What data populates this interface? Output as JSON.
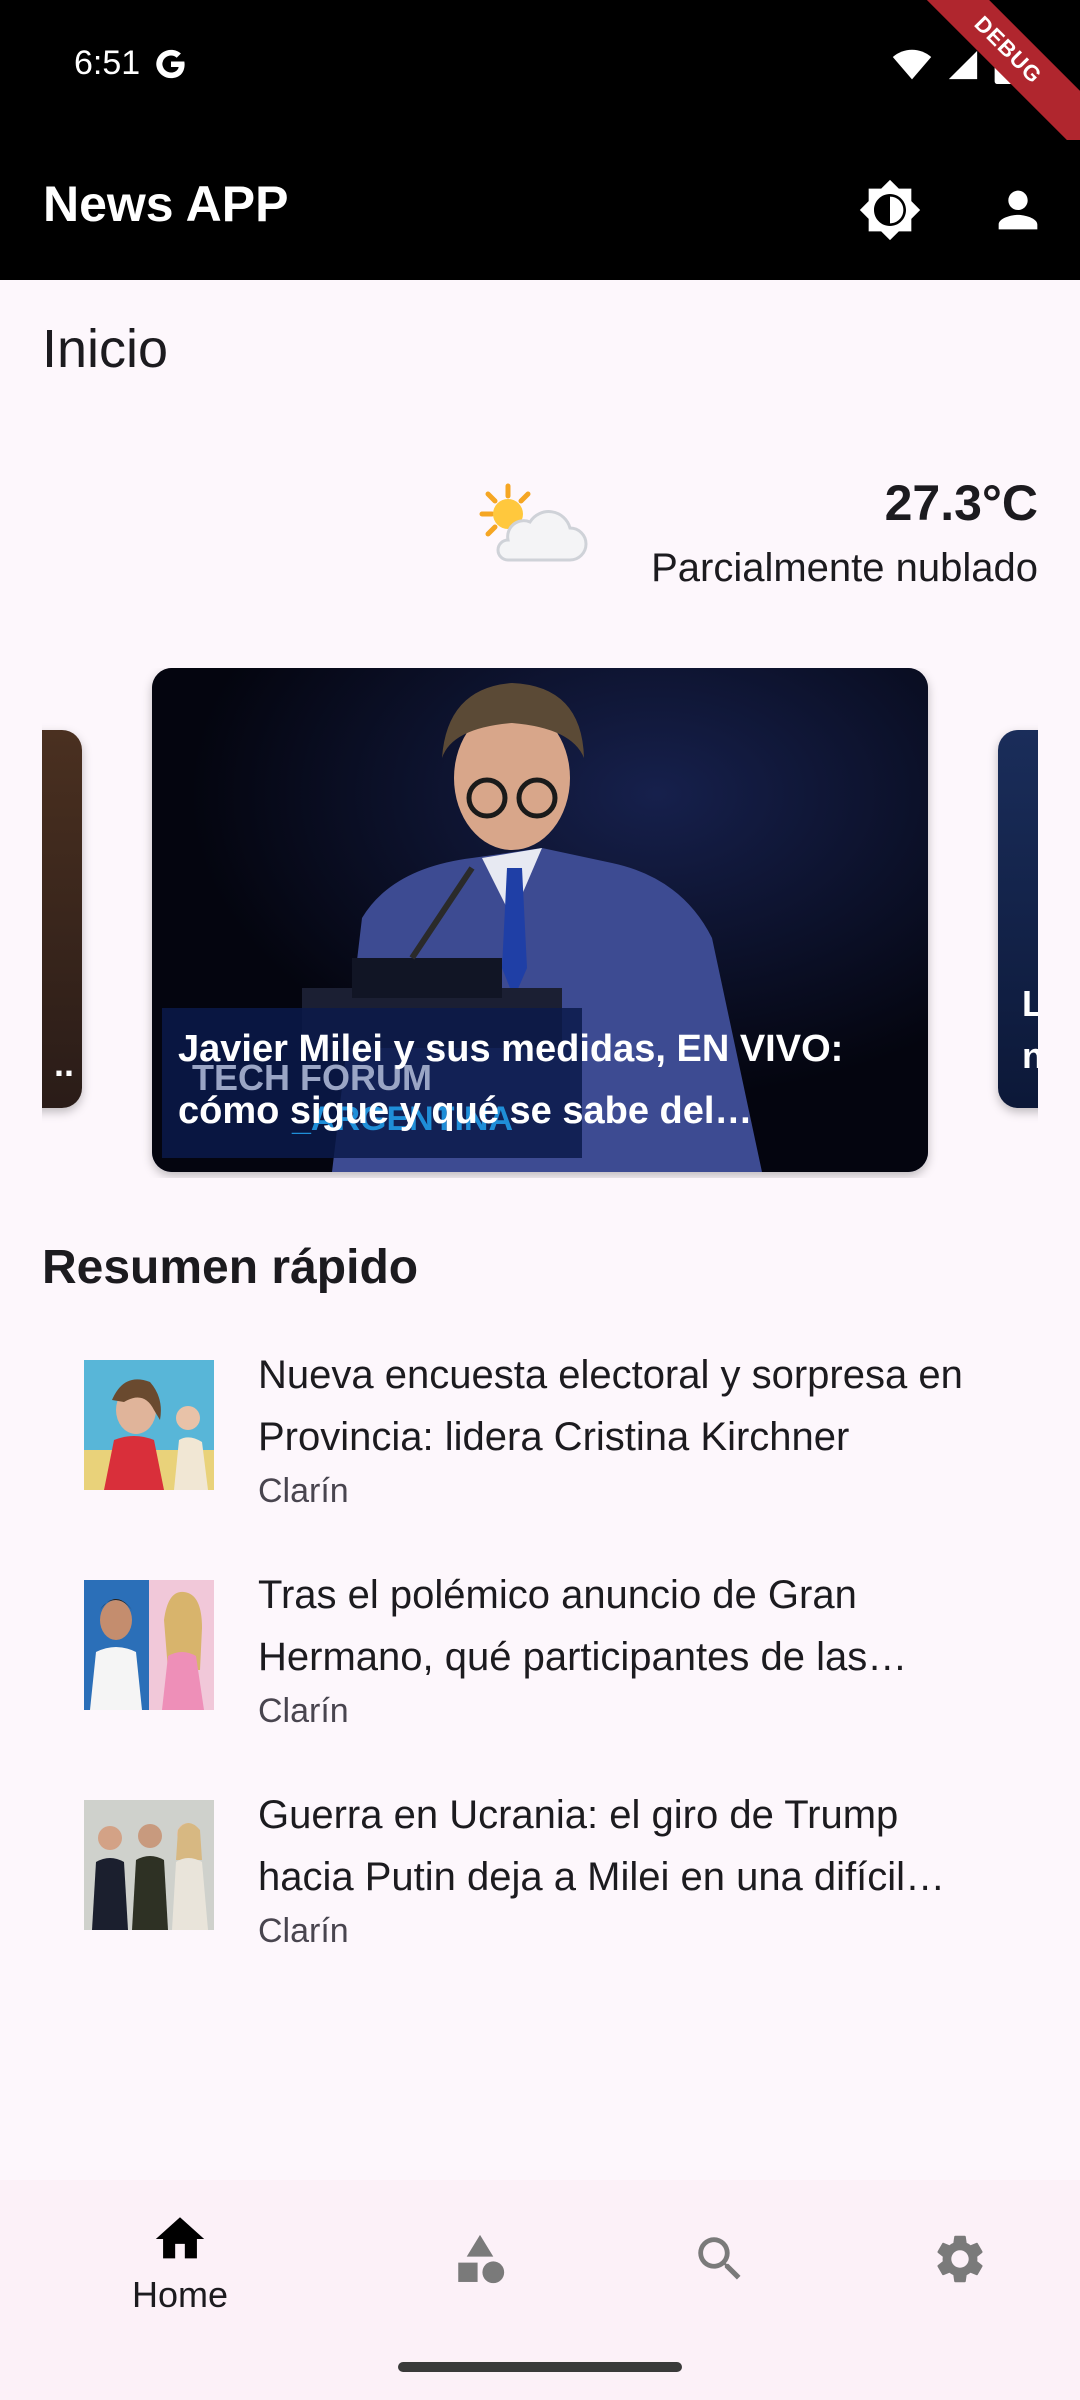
{
  "status_bar": {
    "time": "6:51",
    "debug_label": "DEBUG"
  },
  "app_bar": {
    "title": "News APP"
  },
  "page": {
    "title": "Inicio"
  },
  "weather": {
    "temperature": "27.3°C",
    "description": "Parcialmente nublado",
    "icon": "partly-cloudy-icon"
  },
  "carousel": {
    "main_caption": "Javier Milei y sus medidas, EN VIVO: cómo sigue y qué se sabe del escándalo",
    "left_caption": "..",
    "right_caption": "L\nn",
    "banner_text_1": "TECH FORUM",
    "banner_text_2": "_ARGENTINA"
  },
  "summary": {
    "title": "Resumen rápido",
    "items": [
      {
        "title": "Nueva encuesta electoral y sorpresa en Provincia: lidera Cristina Kirchner",
        "source": "Clarín"
      },
      {
        "title": "Tras el polémico anuncio de Gran Hermano, qué participantes de las ediciones anteriores volverían",
        "source": "Clarín"
      },
      {
        "title": "Guerra en Ucrania: el giro de Trump hacia Putin deja a Milei en una difícil posición",
        "source": "Clarín"
      }
    ]
  },
  "bottom_nav": {
    "items": [
      {
        "label": "Home",
        "icon": "home-icon",
        "active": true
      },
      {
        "label": "",
        "icon": "categories-icon",
        "active": false
      },
      {
        "label": "",
        "icon": "search-icon",
        "active": false
      },
      {
        "label": "",
        "icon": "settings-icon",
        "active": false
      }
    ]
  },
  "colors": {
    "background": "#fdf7fc",
    "app_bar": "#000000",
    "nav_bar": "#fcf1f8",
    "active_icon": "#000000",
    "inactive_icon": "#7a7a7a"
  }
}
